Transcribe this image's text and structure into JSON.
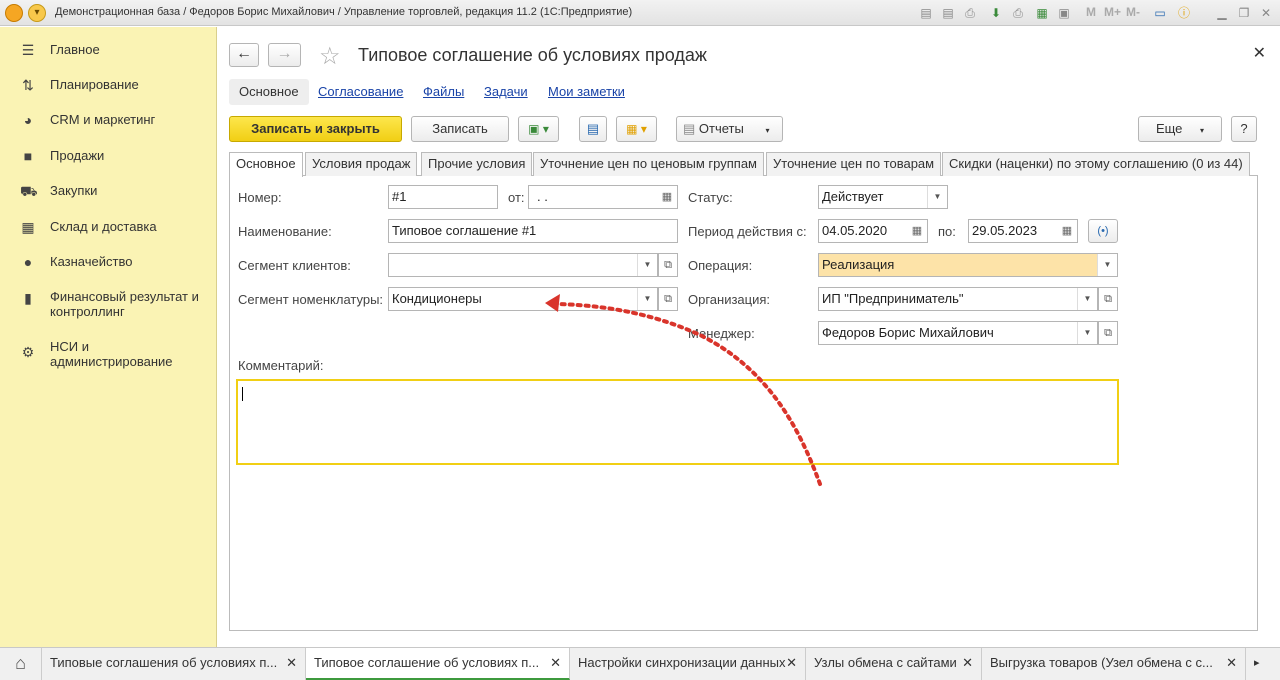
{
  "window": {
    "title": "Демонстрационная база / Федоров Борис Михайлович / Управление торговлей, редакция 11.2  (1С:Предприятие)",
    "toolbar_m": [
      "M",
      "M+",
      "M-"
    ]
  },
  "sidebar": {
    "items": [
      {
        "label": "Главное",
        "icon": "menu-icon"
      },
      {
        "label": "Планирование",
        "icon": "planning-icon"
      },
      {
        "label": "CRM и маркетинг",
        "icon": "crm-icon"
      },
      {
        "label": "Продажи",
        "icon": "bag-icon"
      },
      {
        "label": "Закупки",
        "icon": "cart-icon"
      },
      {
        "label": "Склад и доставка",
        "icon": "warehouse-icon"
      },
      {
        "label": "Казначейство",
        "icon": "treasury-icon"
      },
      {
        "label": "Финансовый результат и контроллинг",
        "icon": "chart-icon"
      },
      {
        "label": "НСИ и администрирование",
        "icon": "gear-icon"
      }
    ]
  },
  "form": {
    "title": "Типовое соглашение об условиях продаж",
    "sections": [
      "Основное",
      "Согласование",
      "Файлы",
      "Задачи",
      "Мои заметки"
    ],
    "buttons": {
      "save_close": "Записать и закрыть",
      "save": "Записать",
      "reports": "Отчеты",
      "more": "Еще",
      "help": "?"
    },
    "tabs": [
      "Основное",
      "Условия продаж",
      "Прочие условия",
      "Уточнение цен по ценовым группам",
      "Уточнение цен по товарам",
      "Скидки (наценки) по этому соглашению (0 из 44)"
    ],
    "fields": {
      "number_label": "Номер:",
      "number_value": "#1",
      "from_label": "от:",
      "from_value": ".  .",
      "name_label": "Наименование:",
      "name_value": "Типовое соглашение #1",
      "client_segment_label": "Сегмент клиентов:",
      "client_segment_value": "",
      "nomenclature_segment_label": "Сегмент номенклатуры:",
      "nomenclature_segment_value": "Кондиционеры",
      "status_label": "Статус:",
      "status_value": "Действует",
      "period_label": "Период действия с:",
      "period_from": "04.05.2020",
      "period_to_label": "по:",
      "period_to": "29.05.2023",
      "operation_label": "Операция:",
      "operation_value": "Реализация",
      "organization_label": "Организация:",
      "organization_value": "ИП \"Предприниматель\"",
      "manager_label": "Менеджер:",
      "manager_value": "Федоров Борис Михайлович",
      "comment_label": "Комментарий:"
    }
  },
  "bottom_tabs": [
    {
      "label": "Типовые соглашения об условиях п...",
      "active": false
    },
    {
      "label": "Типовое соглашение об условиях п...",
      "active": true
    },
    {
      "label": "Настройки синхронизации данных",
      "active": false
    },
    {
      "label": "Узлы обмена с сайтами",
      "active": false
    },
    {
      "label": "Выгрузка товаров (Узел обмена с с...",
      "active": false
    }
  ],
  "colors": {
    "sidebar": "#faf3b4",
    "primary_button": "#f1cf14",
    "annotation_arrow": "#d9342b"
  }
}
